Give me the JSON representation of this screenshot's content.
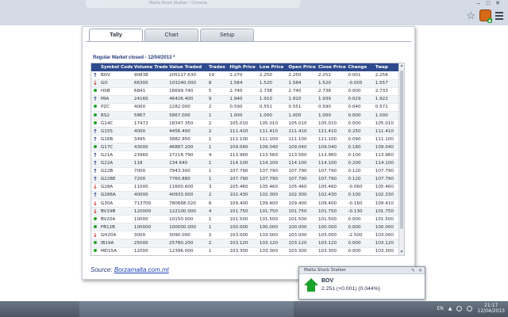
{
  "browser": {
    "tab_title": "Malta Stock Stalker - Chrome"
  },
  "tabs": [
    {
      "label": "Tally",
      "active": true
    },
    {
      "label": "Chart",
      "active": false
    },
    {
      "label": "Setup",
      "active": false
    }
  ],
  "market_status": "Regular Market closed - 12/04/2013 *",
  "columns": [
    "Symbol Code",
    "Volume Traded",
    "Value Traded",
    "Trades",
    "High Price",
    "Low Price",
    "Open Price",
    "Close Price",
    "Change",
    "Twap"
  ],
  "rows": [
    {
      "ind": "up",
      "symbol": "BOV",
      "volume": "90838",
      "value": "205117.630",
      "trades": "19",
      "high": "2.270",
      "low": "2.250",
      "open": "2.250",
      "close": "2.251",
      "change": "0.001",
      "twap": "2.258"
    },
    {
      "ind": "down",
      "symbol": "GO",
      "volume": "66300",
      "value": "103240.000",
      "trades": "8",
      "high": "1.584",
      "low": "1.520",
      "open": "1.584",
      "close": "1.520",
      "change": "-0.005",
      "twap": "1.557"
    },
    {
      "ind": "dot",
      "symbol": "HSB",
      "volume": "6841",
      "value": "18699.740",
      "trades": "5",
      "high": "2.740",
      "low": "2.738",
      "open": "2.740",
      "close": "2.738",
      "change": "0.000",
      "twap": "2.733"
    },
    {
      "ind": "up",
      "symbol": "MIA",
      "volume": "24160",
      "value": "46426.400",
      "trades": "9",
      "high": "1.940",
      "low": "1.910",
      "open": "1.910",
      "close": "1.939",
      "change": "0.029",
      "twap": "1.922"
    },
    {
      "ind": "dot",
      "symbol": "PZC",
      "volume": "4000",
      "value": "2282.000",
      "trades": "2",
      "high": "0.590",
      "low": "0.551",
      "open": "0.551",
      "close": "0.590",
      "change": "0.040",
      "twap": "0.571"
    },
    {
      "ind": "dot",
      "symbol": "RS2",
      "volume": "5867",
      "value": "5867.000",
      "trades": "1",
      "high": "1.000",
      "low": "1.000",
      "open": "1.000",
      "close": "1.000",
      "change": "0.000",
      "twap": "1.000"
    },
    {
      "ind": "dot",
      "symbol": "G14C",
      "volume": "17472",
      "value": "18347.350",
      "trades": "2",
      "high": "105.010",
      "low": "105.010",
      "open": "105.010",
      "close": "105.010",
      "change": "0.000",
      "twap": "105.010"
    },
    {
      "ind": "up",
      "symbol": "G15S",
      "volume": "4000",
      "value": "4456.400",
      "trades": "2",
      "high": "111.410",
      "low": "111.410",
      "open": "111.410",
      "close": "111.410",
      "change": "0.250",
      "twap": "111.410"
    },
    {
      "ind": "up",
      "symbol": "G16B",
      "volume": "3495",
      "value": "3882.950",
      "trades": "1",
      "high": "111.100",
      "low": "111.100",
      "open": "111.100",
      "close": "111.100",
      "change": "0.090",
      "twap": "111.100"
    },
    {
      "ind": "dot",
      "symbol": "G17C",
      "volume": "43000",
      "value": "46887.200",
      "trades": "1",
      "high": "109.040",
      "low": "109.040",
      "open": "109.040",
      "close": "109.040",
      "change": "0.180",
      "twap": "109.040"
    },
    {
      "ind": "up",
      "symbol": "G21A",
      "volume": "23960",
      "value": "27218.790",
      "trades": "4",
      "high": "113.960",
      "low": "113.560",
      "open": "113.560",
      "close": "113.960",
      "change": "0.100",
      "twap": "113.960"
    },
    {
      "ind": "up",
      "symbol": "G22A",
      "volume": "118",
      "value": "134.640",
      "trades": "1",
      "high": "114.100",
      "low": "114.100",
      "open": "114.100",
      "close": "114.100",
      "change": "0.200",
      "twap": "114.100"
    },
    {
      "ind": "up",
      "symbol": "G22B",
      "volume": "7000",
      "value": "7943.300",
      "trades": "1",
      "high": "107.790",
      "low": "107.790",
      "open": "107.790",
      "close": "107.790",
      "change": "0.120",
      "twap": "107.790"
    },
    {
      "ind": "up",
      "symbol": "G228E",
      "volume": "7200",
      "value": "7760.880",
      "trades": "1",
      "high": "107.790",
      "low": "107.790",
      "open": "107.790",
      "close": "107.790",
      "change": "0.120",
      "twap": "107.790"
    },
    {
      "ind": "down",
      "symbol": "G28A",
      "volume": "11000",
      "value": "11600.600",
      "trades": "3",
      "high": "105.460",
      "low": "105.460",
      "open": "105.460",
      "close": "105.460",
      "change": "-0.060",
      "twap": "105.460"
    },
    {
      "ind": "up",
      "symbol": "G288A",
      "volume": "40000",
      "value": "40933.000",
      "trades": "2",
      "high": "102.430",
      "low": "102.300",
      "open": "102.300",
      "close": "102.430",
      "change": "0.100",
      "twap": "102.330"
    },
    {
      "ind": "down",
      "symbol": "G30A",
      "volume": "713700",
      "value": "780668.020",
      "trades": "6",
      "high": "109.400",
      "low": "109.400",
      "open": "109.400",
      "close": "109.400",
      "change": "-0.160",
      "twap": "109.410"
    },
    {
      "ind": "down",
      "symbol": "BV19B",
      "volume": "120000",
      "value": "122100.000",
      "trades": "4",
      "high": "101.750",
      "low": "101.750",
      "open": "101.750",
      "close": "101.750",
      "change": "-0.130",
      "twap": "101.750"
    },
    {
      "ind": "dot",
      "symbol": "BV20A",
      "volume": "10000",
      "value": "10150.000",
      "trades": "1",
      "high": "101.500",
      "low": "101.500",
      "open": "101.500",
      "close": "101.500",
      "change": "0.000",
      "twap": "101.500"
    },
    {
      "ind": "dot",
      "symbol": "FB12B",
      "volume": "100000",
      "value": "100000.000",
      "trades": "1",
      "high": "100.000",
      "low": "100.000",
      "open": "100.000",
      "close": "100.000",
      "change": "0.000",
      "twap": "100.000"
    },
    {
      "ind": "down",
      "symbol": "GH20A",
      "volume": "3000",
      "value": "3090.000",
      "trades": "2",
      "high": "103.000",
      "low": "103.000",
      "open": "103.000",
      "close": "103.000",
      "change": "-2.500",
      "twap": "103.000"
    },
    {
      "ind": "dot",
      "symbol": "IB19A",
      "volume": "25000",
      "value": "25780.200",
      "trades": "2",
      "high": "103.120",
      "low": "103.120",
      "open": "103.120",
      "close": "103.120",
      "change": "0.000",
      "twap": "103.120"
    },
    {
      "ind": "dot",
      "symbol": "MD15A",
      "volume": "12000",
      "value": "12396.000",
      "trades": "1",
      "high": "103.300",
      "low": "103.300",
      "open": "103.300",
      "close": "103.300",
      "change": "0.000",
      "twap": "103.300"
    }
  ],
  "source": {
    "prefix": "Source:",
    "link": "Borzamalta.com.mt"
  },
  "notification": {
    "title": "Malta Stock Stalker",
    "symbol": "BOV",
    "quote": "2.251 (+0.001) (0.044%)"
  },
  "taskbar": {
    "language": "EN",
    "time": "21:17",
    "date": "12/04/2013"
  },
  "colors": {
    "header_blue": "#2d4a8c",
    "up_arrow": "#1f3a8a",
    "down_arrow": "#c41a1a",
    "unchanged_dot": "#22a12d"
  }
}
